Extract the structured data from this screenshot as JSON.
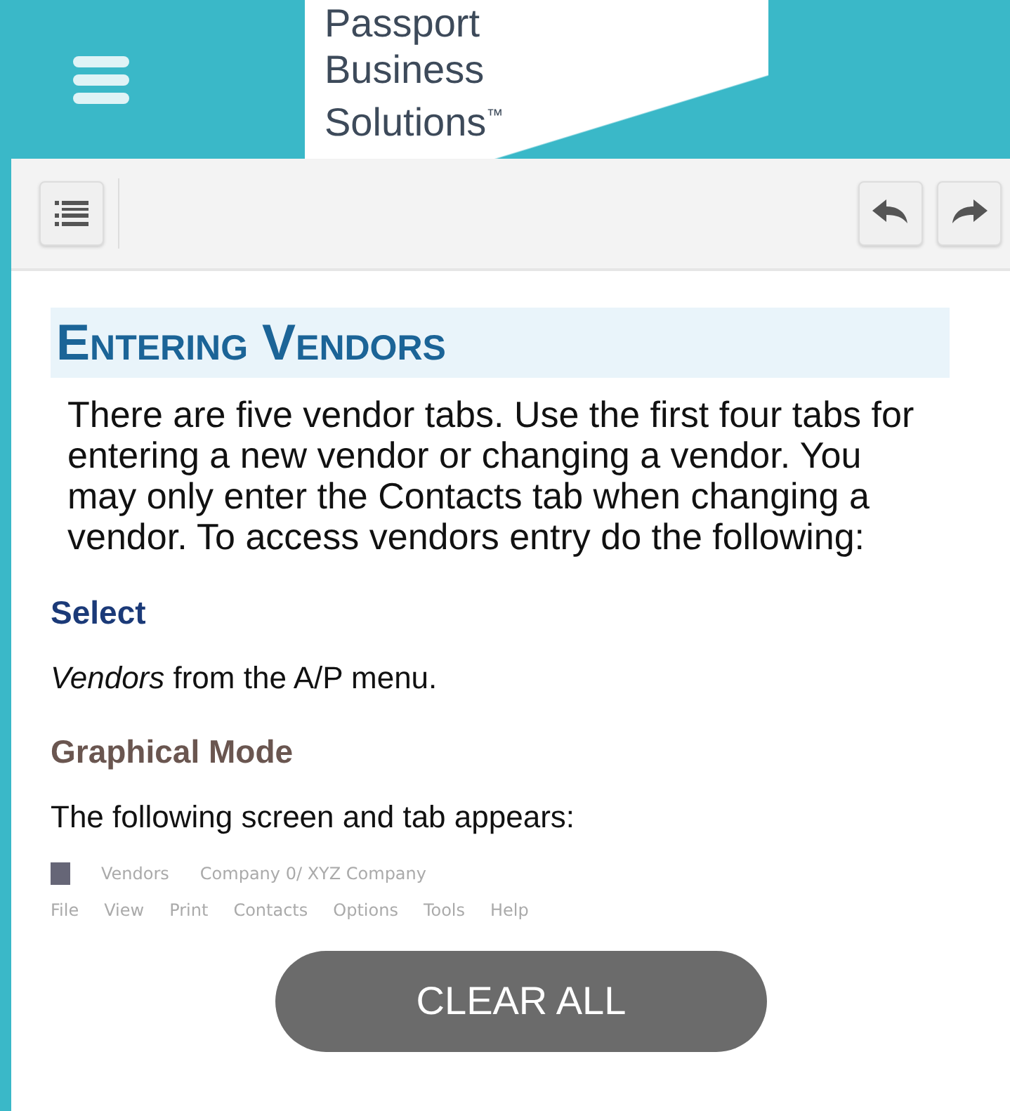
{
  "header": {
    "logo_lines": [
      "Passport",
      "Business",
      "Solutions"
    ],
    "trademark": "™"
  },
  "toolbar": {
    "buttons": [
      {
        "kind": "contents"
      },
      {
        "kind": "back"
      },
      {
        "kind": "forward"
      }
    ]
  },
  "article": {
    "title": "Entering Vendors",
    "intro": "There are five vendor tabs. Use the first four tabs for entering a new vendor or changing a vendor. You may only enter the Contacts tab when changing a vendor. To access vendors entry do the following:",
    "sections": [
      {
        "heading": "Select",
        "kind": "select",
        "text": "*Vendors* from the A/P menu."
      },
      {
        "heading": "Graphical Mode",
        "kind": "mode",
        "text": "The following screen and tab appears:"
      }
    ],
    "embedded_screen": {
      "title": "Vendors",
      "company": "Company 0/ XYZ Company",
      "menu": [
        "File",
        "View",
        "Print",
        "Contacts",
        "Options",
        "Tools",
        "Help"
      ]
    }
  },
  "toast": {
    "label": "CLEAR ALL"
  }
}
